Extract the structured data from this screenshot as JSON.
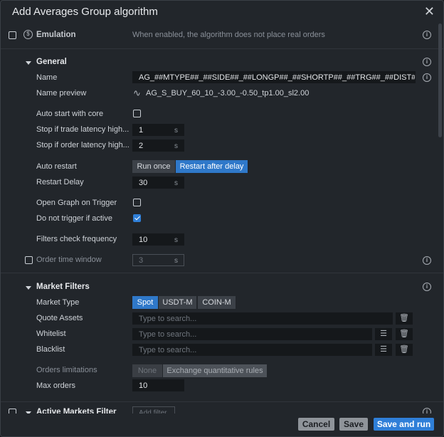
{
  "dialog": {
    "title": "Add Averages Group algorithm"
  },
  "emulation": {
    "label": "Emulation",
    "hint": "When enabled, the algorithm does not place real orders",
    "checked": false
  },
  "general": {
    "title": "General",
    "name_label": "Name",
    "name_value": "AG_##MTYPE##_##SIDE##_##LONGP##_##SHORTP##_##TRG##_##DIST##_tp",
    "preview_label": "Name preview",
    "preview_value": "AG_S_BUY_60_10_-3.00_-0.50_tp1.00_sl2.00",
    "auto_start_label": "Auto start with core",
    "trade_latency_label": "Stop if trade latency high...",
    "trade_latency_value": "1",
    "order_latency_label": "Stop if order latency high...",
    "order_latency_value": "2",
    "unit_s": "s",
    "auto_restart_label": "Auto restart",
    "auto_restart_options": [
      "Run once",
      "Restart after delay"
    ],
    "restart_delay_label": "Restart Delay",
    "restart_delay_value": "30",
    "open_graph_label": "Open Graph on Trigger",
    "no_trigger_label": "Do not trigger if active",
    "filters_freq_label": "Filters check frequency",
    "filters_freq_value": "10",
    "order_window_label": "Order time window",
    "order_window_value": "3"
  },
  "market_filters": {
    "title": "Market Filters",
    "market_type_label": "Market Type",
    "market_types": [
      "Spot",
      "USDT-M",
      "COIN-M"
    ],
    "quote_assets_label": "Quote Assets",
    "whitelist_label": "Whitelist",
    "blacklist_label": "Blacklist",
    "search_placeholder": "Type to search...",
    "orders_limit_label": "Orders limitations",
    "orders_limit_options": [
      "None",
      "Exchange quantitative rules"
    ],
    "max_orders_label": "Max orders",
    "max_orders_value": "10"
  },
  "active_markets": {
    "title": "Active Markets Filter",
    "add_filter": "Add filter"
  },
  "footer": {
    "cancel": "Cancel",
    "save": "Save",
    "save_run": "Save and run"
  },
  "icons": {
    "info": "info-icon",
    "trash": "trash-icon",
    "list": "list-icon",
    "wave": "wave-icon",
    "power": "power-icon",
    "close": "close-icon"
  },
  "colors": {
    "accent": "#2f7fd8",
    "background": "#22262b",
    "input": "#15181b"
  }
}
